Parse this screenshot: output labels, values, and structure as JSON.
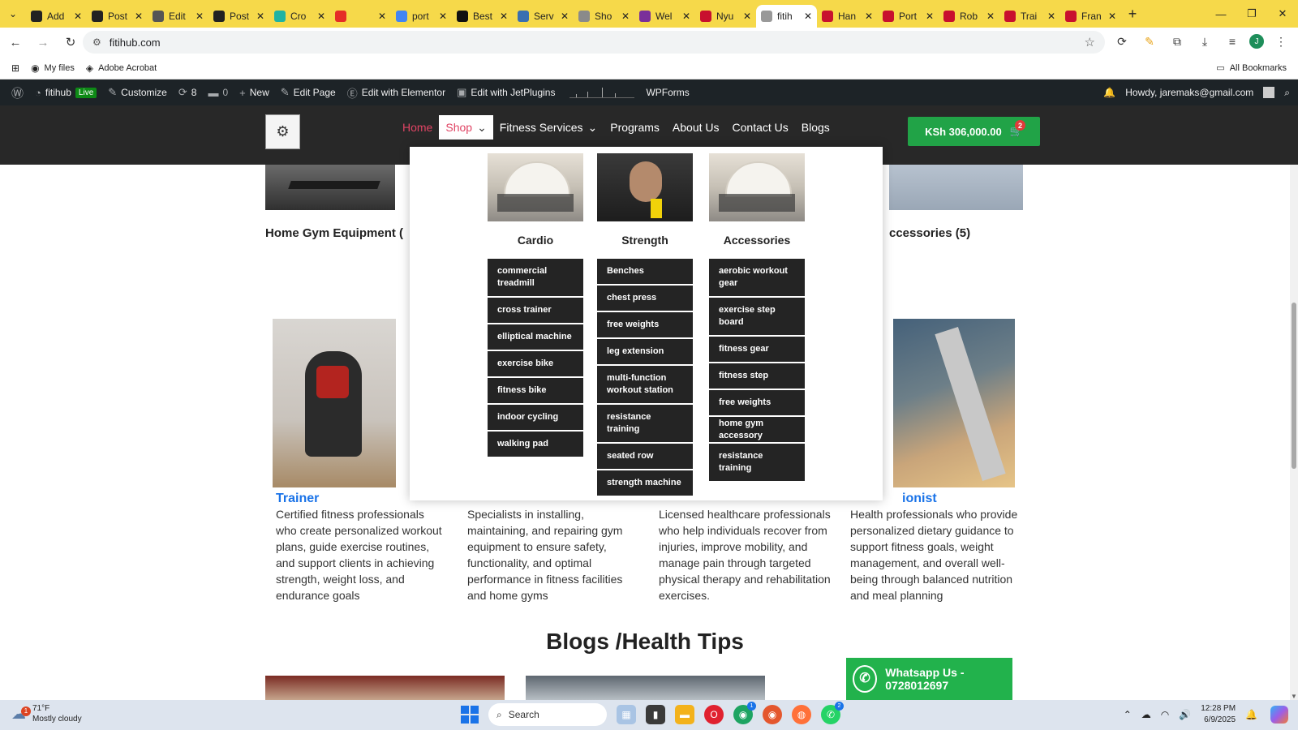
{
  "browser": {
    "tabs": [
      {
        "label": "Add",
        "color": "#222222"
      },
      {
        "label": "Post",
        "color": "#222222"
      },
      {
        "label": "Edit",
        "color": "#555555"
      },
      {
        "label": "Post",
        "color": "#222222"
      },
      {
        "label": "Cro",
        "color": "#1fb3a2"
      },
      {
        "label": "",
        "color": "#e52d27"
      },
      {
        "label": "port",
        "color": "#4285f4"
      },
      {
        "label": "Best",
        "color": "#111111"
      },
      {
        "label": "Serv",
        "color": "#3a6fb0"
      },
      {
        "label": "Sho",
        "color": "#8a8a8a"
      },
      {
        "label": "Wel",
        "color": "#7a2f9a"
      },
      {
        "label": "Nyu",
        "color": "#c8102e"
      },
      {
        "label": "fitih",
        "color": "#999999",
        "active": true
      },
      {
        "label": "Han",
        "color": "#c8102e"
      },
      {
        "label": "Port",
        "color": "#c8102e"
      },
      {
        "label": "Rob",
        "color": "#c8102e"
      },
      {
        "label": "Trai",
        "color": "#c8102e"
      },
      {
        "label": "Fran",
        "color": "#c8102e"
      }
    ],
    "url": "fitihub.com",
    "bookmarks": [
      "My files",
      "Adobe Acrobat"
    ],
    "all_bookmarks": "All Bookmarks"
  },
  "wpbar": {
    "site": "fitihub",
    "live": "Live",
    "customize": "Customize",
    "updates": "8",
    "comments": "0",
    "new": "New",
    "edit_page": "Edit Page",
    "elementor": "Edit with Elementor",
    "jetplugins": "Edit with JetPlugins",
    "wpforms": "WPForms",
    "howdy": "Howdy, jaremaks@gmail.com"
  },
  "nav": {
    "home": "Home",
    "shop": "Shop",
    "fitness_services": "Fitness Services",
    "programs": "Programs",
    "about": "About Us",
    "contact": "Contact Us",
    "blogs": "Blogs",
    "cart_total": "KSh 306,000.00",
    "cart_count": "2"
  },
  "megamenu": {
    "cardio": {
      "title": "Cardio",
      "items": [
        "commercial treadmill",
        "cross trainer",
        "elliptical machine",
        "exercise bike",
        "fitness bike",
        "indoor cycling",
        "walking pad"
      ]
    },
    "strength": {
      "title": "Strength",
      "items": [
        "Benches",
        "chest press",
        "free weights",
        "leg extension",
        "multi-function workout station",
        "resistance training",
        "seated row",
        "strength machine"
      ]
    },
    "accessories": {
      "title": "Accessories",
      "items": [
        "aerobic workout gear",
        "exercise step board",
        "fitness gear",
        "fitness step",
        "free weights",
        "home gym accessory",
        "resistance training"
      ]
    }
  },
  "page": {
    "cat_left": "Home Gym Equipment (",
    "cat_right": "ccessories (5)",
    "trainer_title": "Trainer",
    "trainer_desc": "Certified fitness professionals who create personalized workout plans, guide exercise routines, and support clients in achieving strength, weight loss, and endurance goals",
    "tech_desc": "Specialists in installing, maintaining, and repairing gym equipment to ensure safety, functionality, and optimal performance in fitness facilities and home gyms",
    "physio_desc": "Licensed healthcare professionals who help individuals recover from injuries, improve mobility, and manage pain through targeted physical therapy and rehabilitation exercises.",
    "nutri_title": "ionist",
    "nutri_desc": "Health professionals who provide personalized dietary guidance to support fitness goals, weight management, and overall well-being through balanced nutrition and meal planning",
    "blogs_title": "Blogs /Health Tips",
    "whatsapp": "Whatsapp Us - 0728012697"
  },
  "taskbar": {
    "temp": "71°F",
    "weather": "Mostly cloudy",
    "weather_badge": "1",
    "search": "Search",
    "time": "12:28 PM",
    "date": "6/9/2025"
  }
}
